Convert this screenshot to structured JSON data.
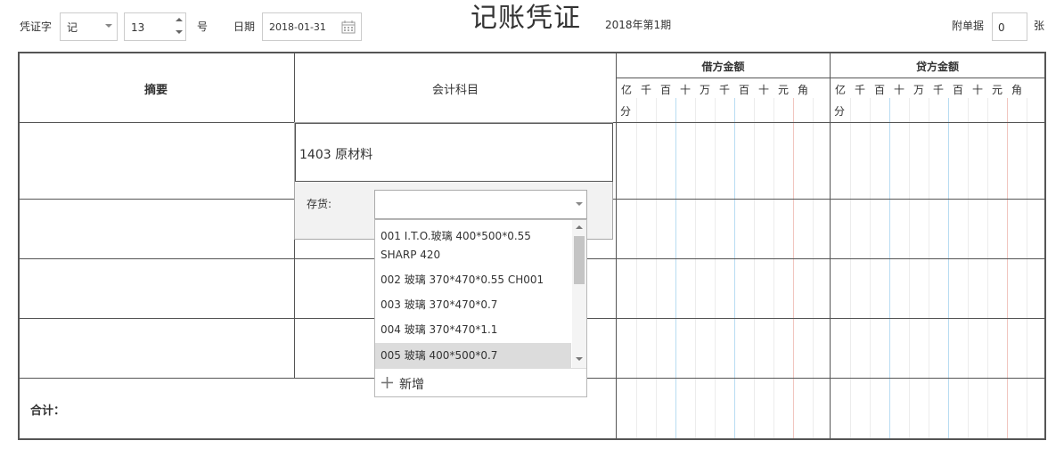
{
  "toolbar": {
    "voucher_word_label": "凭证字",
    "voucher_word_value": "记",
    "voucher_no_value": "13",
    "voucher_no_suffix": "号",
    "date_label": "日期",
    "date_value": "2018-01-31",
    "title": "记账凭证",
    "period": "2018年第1期",
    "attachments_label": "附单据",
    "attachments_value": "0",
    "attachments_unit": "张"
  },
  "table": {
    "col_summary": "摘要",
    "col_account": "会计科目",
    "col_debit": "借方金额",
    "col_credit": "贷方金额",
    "digit_units": [
      "亿",
      "千",
      "百",
      "十",
      "万",
      "千",
      "百",
      "十",
      "元",
      "角"
    ],
    "digit_unit_last": "分",
    "total_label": "合计："
  },
  "account_cell": {
    "value": "1403 原材料",
    "aux_label": "存货:",
    "aux_value": ""
  },
  "dropdown": {
    "options": [
      "001 I.T.O.玻璃 400*500*0.55",
      "SHARP 420",
      "002 玻璃 370*470*0.55 CH001",
      "003 玻璃 370*470*0.7",
      "004 玻璃 370*470*1.1",
      "005 玻璃 400*500*0.7"
    ],
    "new_label": "新增"
  }
}
